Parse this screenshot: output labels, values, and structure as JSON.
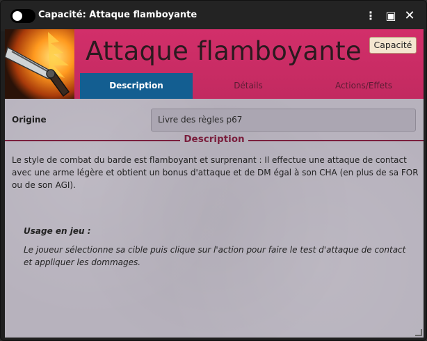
{
  "window": {
    "title": "Capacité: Attaque flamboyante",
    "kebab_glyph": "⋮",
    "sheet_glyph": "▣",
    "close_glyph": "✕"
  },
  "header": {
    "name": "Attaque flamboyante",
    "type_badge": "Capacité",
    "portrait_icon": "flaming-sword-icon",
    "accent_color": "#d22f6a"
  },
  "tabs": [
    {
      "label": "Description",
      "active": true
    },
    {
      "label": "Détails",
      "active": false
    },
    {
      "label": "Actions/Effets",
      "active": false
    }
  ],
  "fields": {
    "origin_label": "Origine",
    "origin_value": "Livre des règles p67"
  },
  "section": {
    "description_title": "Description"
  },
  "description": {
    "text": "Le style de combat du barde est flamboyant et surprenant : Il effectue une attaque de contact avec une arme légère et obtient un bonus d'attaque et de DM égal à son CHA (en plus de sa FOR ou de son AGI).",
    "usage_title": "Usage en jeu :",
    "usage_text": "Le joueur sélectionne sa cible puis clique sur l'action pour faire le test d'attaque de contact et appliquer les dommages."
  }
}
